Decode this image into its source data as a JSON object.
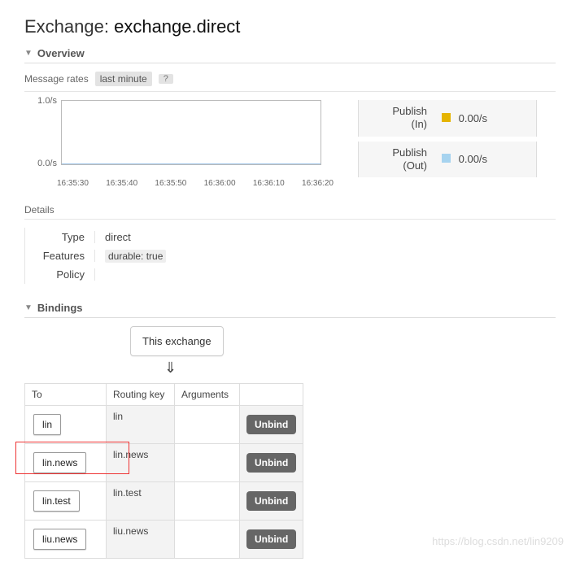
{
  "title_prefix": "Exchange:",
  "title_name": "exchange.direct",
  "overview": {
    "label": "Overview",
    "rates_label": "Message rates",
    "rates_range": "last minute",
    "help": "?"
  },
  "chart_data": {
    "type": "line",
    "ylabel": "",
    "ylim": [
      "0.0/s",
      "1.0/s"
    ],
    "x_ticks": [
      "16:35:30",
      "16:35:40",
      "16:35:50",
      "16:36:00",
      "16:36:10",
      "16:36:20"
    ],
    "series": [
      {
        "name": "Publish (In)",
        "color": "#e5b400",
        "values": [
          0,
          0,
          0,
          0,
          0,
          0
        ],
        "display": "0.00/s"
      },
      {
        "name": "Publish (Out)",
        "color": "#a6d3ef",
        "values": [
          0,
          0,
          0,
          0,
          0,
          0
        ],
        "display": "0.00/s"
      }
    ]
  },
  "legend": {
    "pub_in_label": "Publish\n(In)",
    "pub_in_val": "0.00/s",
    "pub_out_label": "Publish\n(Out)",
    "pub_out_val": "0.00/s"
  },
  "details": {
    "label": "Details",
    "type_k": "Type",
    "type_v": "direct",
    "features_k": "Features",
    "features_v": "durable: true",
    "policy_k": "Policy",
    "policy_v": ""
  },
  "bindings": {
    "label": "Bindings",
    "this_exchange": "This exchange",
    "cols": {
      "to": "To",
      "rk": "Routing key",
      "args": "Arguments"
    },
    "unbind": "Unbind",
    "rows": [
      {
        "to": "lin",
        "rk": "lin",
        "args": ""
      },
      {
        "to": "lin.news",
        "rk": "lin.news",
        "args": ""
      },
      {
        "to": "lin.test",
        "rk": "lin.test",
        "args": ""
      },
      {
        "to": "liu.news",
        "rk": "liu.news",
        "args": ""
      }
    ]
  },
  "watermark": "https://blog.csdn.net/lin9209"
}
